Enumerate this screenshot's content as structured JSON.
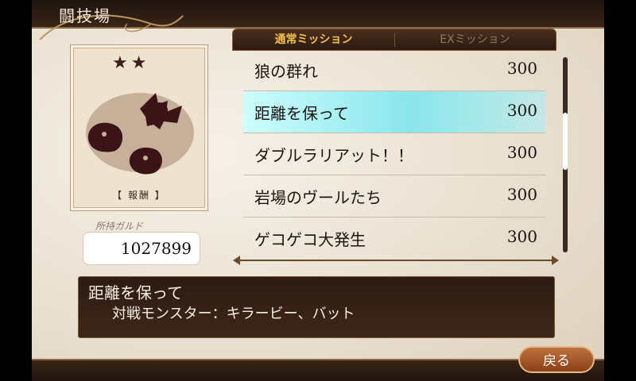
{
  "header": {
    "title": "闘技場"
  },
  "reward": {
    "stars": "★★",
    "label": "【 報酬 】"
  },
  "money": {
    "label": "所持ガルド",
    "value": "1027899"
  },
  "tabs": [
    {
      "label": "通常ミッション",
      "active": true
    },
    {
      "label": "EXミッション",
      "active": false
    }
  ],
  "missions": [
    {
      "name": "狼の群れ",
      "reward": "300"
    },
    {
      "name": "距離を保って",
      "reward": "300",
      "selected": true
    },
    {
      "name": "ダブルラリアット！！",
      "reward": "300"
    },
    {
      "name": "岩場のヴールたち",
      "reward": "300"
    },
    {
      "name": "ゲコゲコ大発生",
      "reward": "300"
    }
  ],
  "description": {
    "title": "距離を保って",
    "body": "対戦モンスター：キラービー、バット"
  },
  "footer": {
    "back_label": "戻る"
  },
  "colors": {
    "accent_tab": "#f2c24a",
    "highlight": "#9feaf2",
    "panel_dark": "#2d1b12"
  }
}
